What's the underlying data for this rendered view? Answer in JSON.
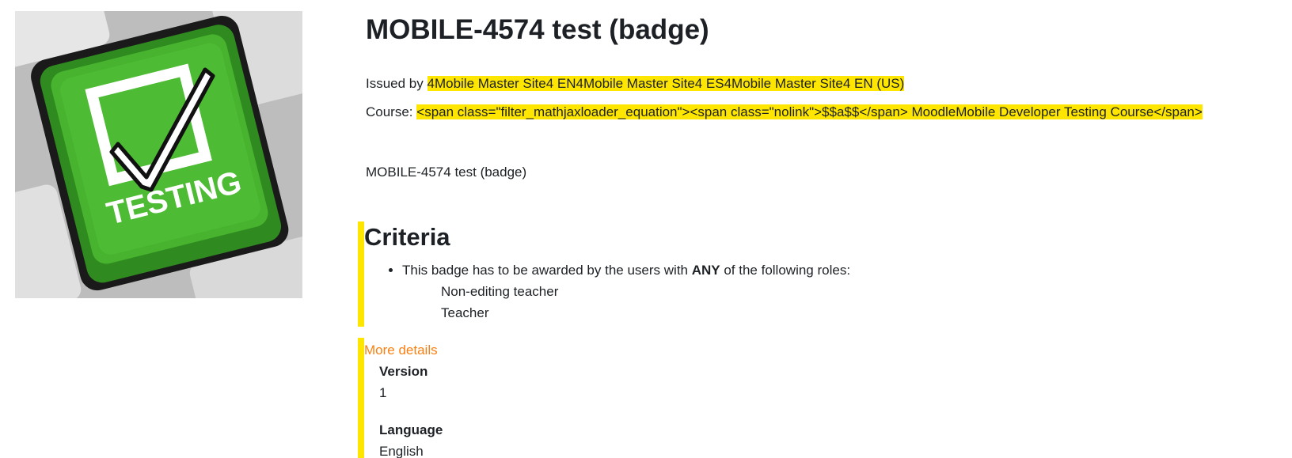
{
  "badge": {
    "title": "MOBILE-4574 test (badge)",
    "image_icon": "testing-keyboard-key-icon",
    "image_text": "TESTING",
    "issued_by_label": "Issued by",
    "issuer": "4Mobile Master Site4 EN4Mobile Master Site4 ES4Mobile Master Site4 EN (US)",
    "course_label": "Course:",
    "course": "<span class=\"filter_mathjaxloader_equation\"><span class=\"nolink\">$$a$$</span> MoodleMobile Developer Testing Course</span>",
    "description": "MOBILE-4574 test (badge)"
  },
  "criteria": {
    "heading": "Criteria",
    "item_prefix": "This badge has to be awarded by the users with ",
    "item_emphasis": "ANY",
    "item_suffix": " of the following roles:",
    "roles": [
      "Non-editing teacher",
      "Teacher"
    ]
  },
  "details": {
    "toggle_label": "More details",
    "fields": [
      {
        "term": "Version",
        "value": "1"
      },
      {
        "term": "Language",
        "value": "English"
      }
    ]
  },
  "colors": {
    "highlight": "#ffe600",
    "link": "#f98012",
    "badge_green": "#3fa52a"
  }
}
